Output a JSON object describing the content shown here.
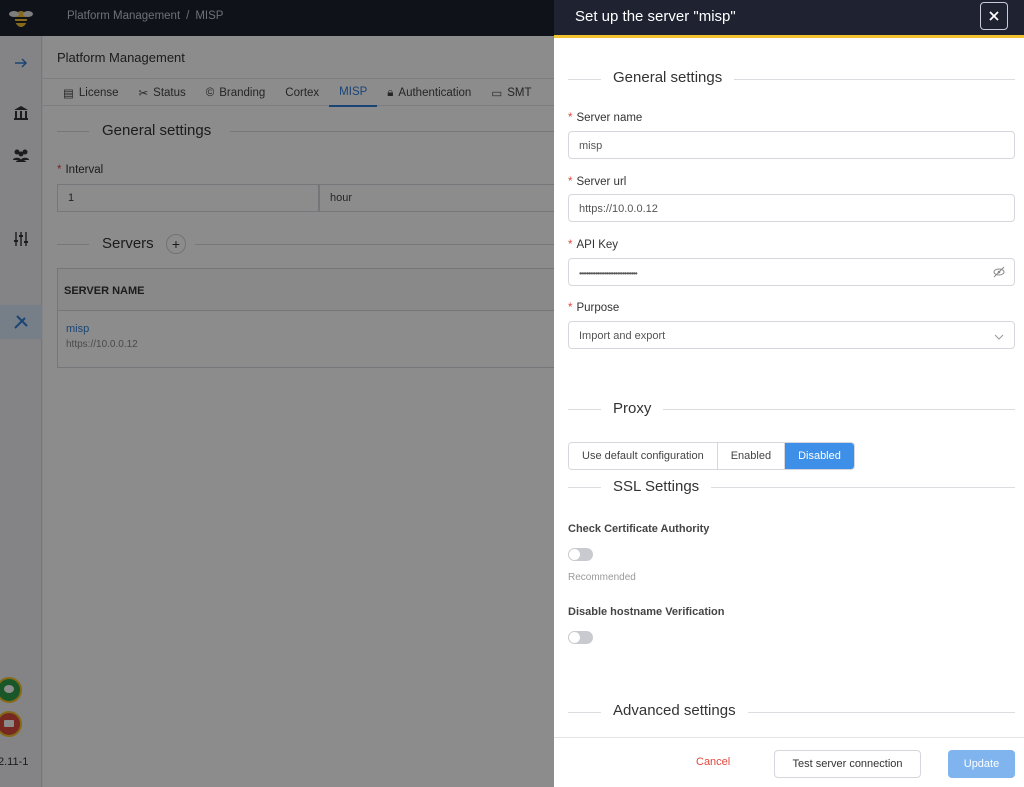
{
  "app": {
    "breadcrumb": [
      "Platform Management",
      "/",
      "MISP"
    ],
    "version": "2.11-1"
  },
  "sidebar": {
    "icons": [
      "arrow-right-icon",
      "bank-icon",
      "users-icon",
      "sliders-icon",
      "tools-icon"
    ],
    "active": "tools-icon"
  },
  "main": {
    "title": "Platform Management",
    "tabs": [
      {
        "label": "License",
        "icon": "document-icon"
      },
      {
        "label": "Status",
        "icon": "wrench-icon"
      },
      {
        "label": "Branding",
        "icon": "copyright-icon"
      },
      {
        "label": "Cortex",
        "icon": ""
      },
      {
        "label": "MISP",
        "icon": "",
        "active": true
      },
      {
        "label": "Authentication",
        "icon": "lock-icon"
      },
      {
        "label": "SMT",
        "icon": "inbox-icon"
      }
    ],
    "general_settings": "General settings",
    "interval_label": "Interval",
    "interval_value": "1",
    "interval_unit": "hour",
    "servers_title": "Servers",
    "table_header": "SERVER NAME",
    "server_row": {
      "name": "misp",
      "url": "https://10.0.0.12"
    }
  },
  "drawer": {
    "title": "Set up the server \"misp\"",
    "general_settings": "General settings",
    "server_name_label": "Server name",
    "server_name_value": "misp",
    "server_url_label": "Server url",
    "server_url_value": "https://10.0.0.12",
    "api_key_label": "API Key",
    "api_key_value": "••••••••••••••••••••••••••••••••",
    "purpose_label": "Purpose",
    "purpose_value": "Import and export",
    "proxy_title": "Proxy",
    "proxy_options": [
      "Use default configuration",
      "Enabled",
      "Disabled"
    ],
    "proxy_selected": "Disabled",
    "ssl_title": "SSL Settings",
    "check_ca_label": "Check Certificate Authority",
    "check_ca_hint": "Recommended",
    "disable_hostname_label": "Disable hostname Verification",
    "advanced_title": "Advanced settings",
    "cancel": "Cancel",
    "test": "Test server connection",
    "update": "Update"
  },
  "colors": {
    "accent": "#3d8fe8",
    "header": "#1e2231",
    "highlight": "#f2c230",
    "danger": "#e0483d"
  }
}
